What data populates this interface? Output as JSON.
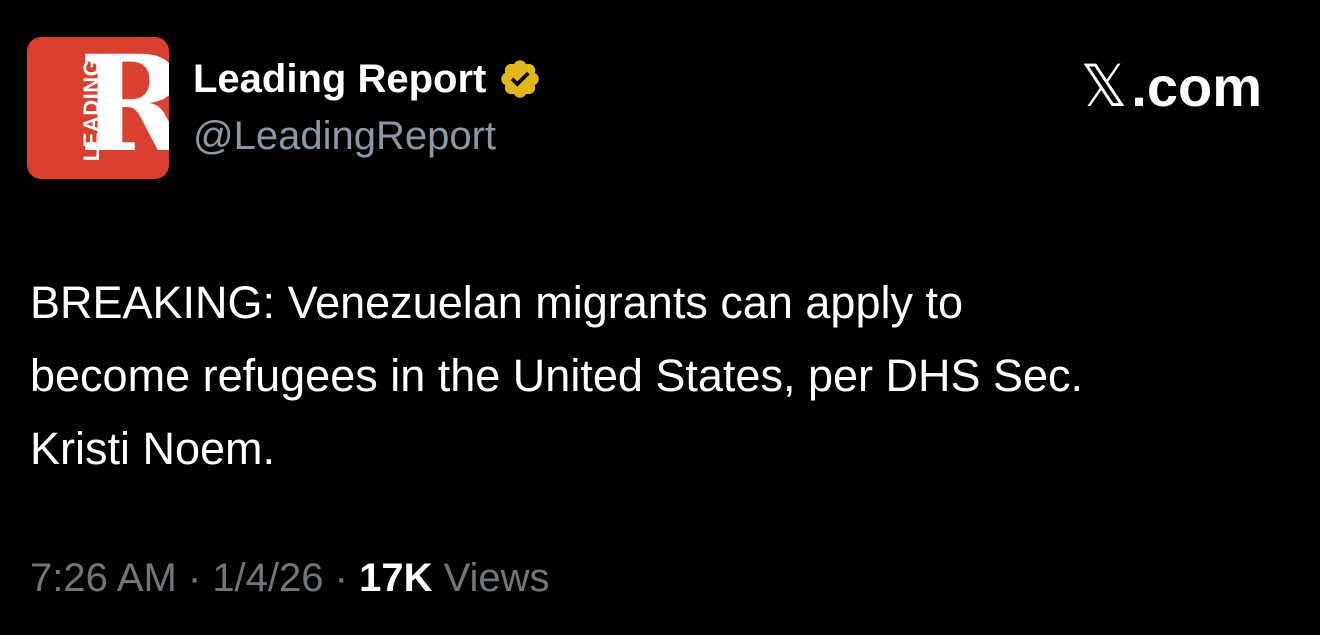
{
  "author": {
    "avatar_letter": "R",
    "avatar_side_text": "LEADING",
    "display_name": "Leading Report",
    "handle": "@LeadingReport",
    "verified": true,
    "verified_icon": "verified-badge-icon",
    "avatar_color": "#d9402f",
    "verified_color": "#e2b719"
  },
  "site": {
    "x_mark": "𝕏",
    "domain": ".com"
  },
  "tweet": {
    "text": "BREAKING: Venezuelan migrants can apply to\nbecome refugees in the United States, per DHS Sec.\nKristi Noem."
  },
  "meta": {
    "time": "7:26 AM",
    "sep1": " · ",
    "date": "1/4/26",
    "sep2": " · ",
    "views_count": "17K",
    "views_label": " Views"
  }
}
